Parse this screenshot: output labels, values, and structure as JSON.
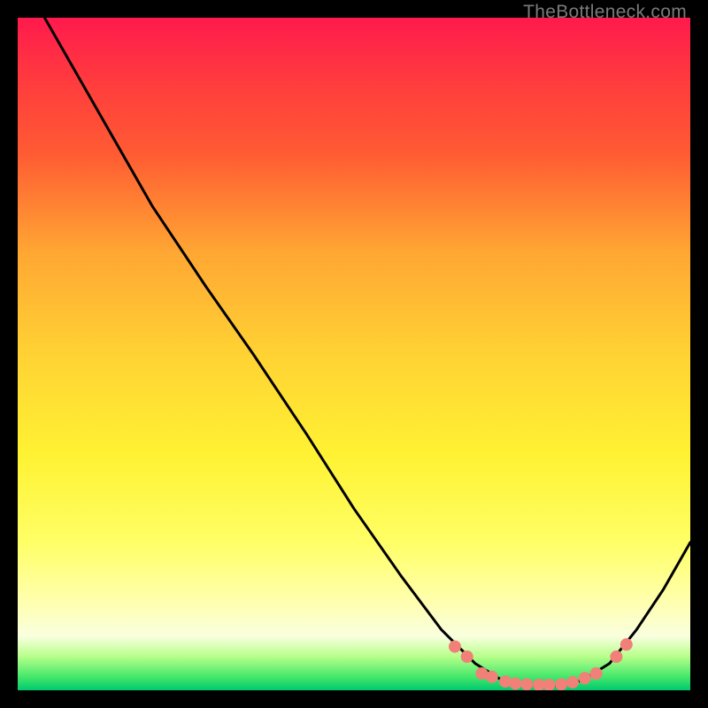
{
  "attribution": "TheBottleneck.com",
  "chart_data": {
    "type": "line",
    "title": "",
    "xlabel": "",
    "ylabel": "",
    "xlim": [
      0,
      100
    ],
    "ylim": [
      0,
      100
    ],
    "background_gradient": {
      "stops": [
        {
          "pos": 0,
          "color": "#ff1a4d"
        },
        {
          "pos": 0.1,
          "color": "#ff3d3d"
        },
        {
          "pos": 0.2,
          "color": "#ff5a33"
        },
        {
          "pos": 0.35,
          "color": "#ffa733"
        },
        {
          "pos": 0.5,
          "color": "#ffd233"
        },
        {
          "pos": 0.65,
          "color": "#fff233"
        },
        {
          "pos": 0.78,
          "color": "#ffff66"
        },
        {
          "pos": 0.87,
          "color": "#ffffb0"
        },
        {
          "pos": 0.92,
          "color": "#f9ffdf"
        },
        {
          "pos": 0.95,
          "color": "#b6ff8a"
        },
        {
          "pos": 0.98,
          "color": "#45e86b"
        },
        {
          "pos": 1.0,
          "color": "#00c96e"
        }
      ]
    },
    "series": [
      {
        "name": "bottleneck-curve",
        "color": "#000000",
        "points": [
          {
            "x": 4.0,
            "y": 100.0
          },
          {
            "x": 12.0,
            "y": 86.0
          },
          {
            "x": 20.0,
            "y": 72.0
          },
          {
            "x": 28.0,
            "y": 60.0
          },
          {
            "x": 35.0,
            "y": 50.0
          },
          {
            "x": 43.0,
            "y": 38.0
          },
          {
            "x": 50.0,
            "y": 27.0
          },
          {
            "x": 57.0,
            "y": 17.0
          },
          {
            "x": 63.0,
            "y": 9.0
          },
          {
            "x": 68.0,
            "y": 4.0
          },
          {
            "x": 72.0,
            "y": 1.5
          },
          {
            "x": 76.0,
            "y": 0.8
          },
          {
            "x": 80.0,
            "y": 0.7
          },
          {
            "x": 84.0,
            "y": 1.5
          },
          {
            "x": 88.0,
            "y": 4.0
          },
          {
            "x": 92.0,
            "y": 9.0
          },
          {
            "x": 96.0,
            "y": 15.0
          },
          {
            "x": 100.0,
            "y": 22.0
          }
        ]
      }
    ],
    "markers": [
      {
        "x": 65.0,
        "y": 6.5,
        "color": "#f08078"
      },
      {
        "x": 66.8,
        "y": 5.0,
        "color": "#f08078"
      },
      {
        "x": 69.0,
        "y": 2.5,
        "color": "#f08078"
      },
      {
        "x": 70.5,
        "y": 2.0,
        "color": "#f08078"
      },
      {
        "x": 72.5,
        "y": 1.3,
        "color": "#f08078"
      },
      {
        "x": 74.0,
        "y": 1.0,
        "color": "#f08078"
      },
      {
        "x": 75.7,
        "y": 0.9,
        "color": "#f08078"
      },
      {
        "x": 77.5,
        "y": 0.8,
        "color": "#f08078"
      },
      {
        "x": 79.0,
        "y": 0.8,
        "color": "#f08078"
      },
      {
        "x": 80.8,
        "y": 0.9,
        "color": "#f08078"
      },
      {
        "x": 82.5,
        "y": 1.2,
        "color": "#f08078"
      },
      {
        "x": 84.3,
        "y": 1.8,
        "color": "#f08078"
      },
      {
        "x": 86.0,
        "y": 2.5,
        "color": "#f08078"
      },
      {
        "x": 89.0,
        "y": 5.0,
        "color": "#f08078"
      },
      {
        "x": 90.5,
        "y": 6.8,
        "color": "#f08078"
      }
    ]
  }
}
